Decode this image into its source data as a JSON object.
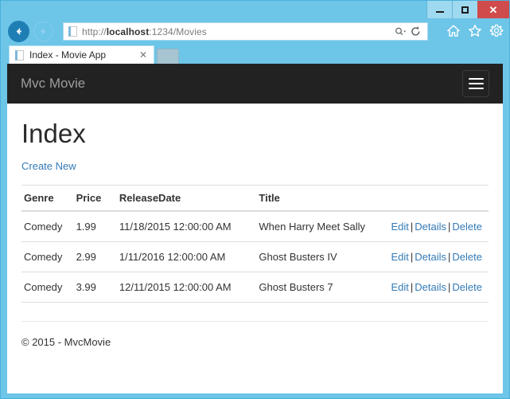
{
  "browser": {
    "window_controls": {
      "minimize": "minimize-icon",
      "maximize": "maximize-icon",
      "close": "✕"
    },
    "back_icon": "back-arrow-icon",
    "forward_icon": "forward-arrow-icon",
    "address": {
      "url_scheme": "http://",
      "url_host": "localhost",
      "url_rest": ":1234/Movies",
      "full_url": "http://localhost:1234/Movies",
      "search_icon": "search-dropdown-icon",
      "refresh_icon": "refresh-icon"
    },
    "toolbar": {
      "home": "home-icon",
      "favorites": "star-icon",
      "tools": "gear-icon"
    },
    "tab": {
      "title": "Index - Movie App",
      "close_label": "✕",
      "new_tab_label": ""
    }
  },
  "site": {
    "brand": "Mvc Movie",
    "toggle_icon": "hamburger-menu-icon"
  },
  "page": {
    "title": "Index",
    "create_new_label": "Create New",
    "footer": "© 2015 - MvcMovie"
  },
  "table": {
    "columns": [
      "Genre",
      "Price",
      "ReleaseDate",
      "Title"
    ],
    "actions": {
      "edit": "Edit",
      "details": "Details",
      "delete": "Delete",
      "separator": "|"
    },
    "rows": [
      {
        "genre": "Comedy",
        "price": "1.99",
        "release_date": "11/18/2015 12:00:00 AM",
        "title": "When Harry Meet Sally"
      },
      {
        "genre": "Comedy",
        "price": "2.99",
        "release_date": "1/11/2016 12:00:00 AM",
        "title": "Ghost Busters IV"
      },
      {
        "genre": "Comedy",
        "price": "3.99",
        "release_date": "12/11/2015 12:00:00 AM",
        "title": "Ghost Busters 7"
      }
    ]
  },
  "colors": {
    "chrome_blue": "#6dc5e8",
    "navbar_dark": "#222222",
    "link_blue": "#337ab7",
    "close_red": "#d04b4b"
  }
}
